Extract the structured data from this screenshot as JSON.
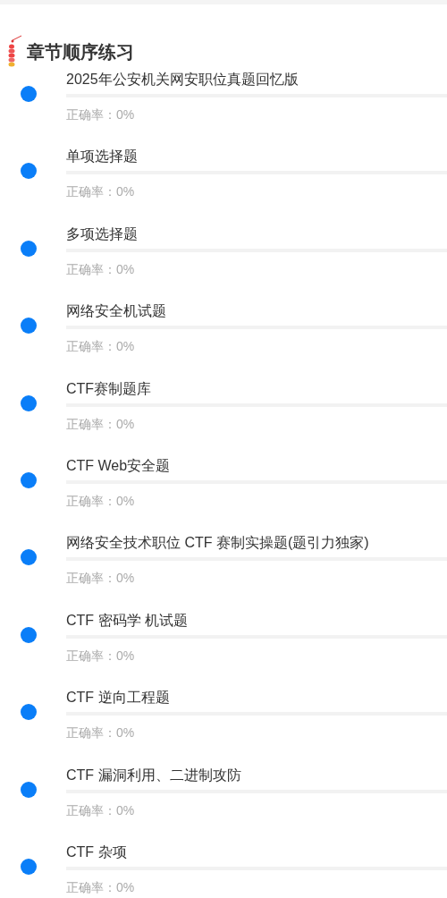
{
  "header": {
    "title": "章节顺序练习"
  },
  "chapters": [
    {
      "title": "2025年公安机关网安职位真题回忆版",
      "rate": "正确率：0%",
      "level": 0
    },
    {
      "title": "单项选择题",
      "rate": "正确率：0%",
      "level": 0
    },
    {
      "title": "多项选择题",
      "rate": "正确率：0%",
      "level": 0
    },
    {
      "title": "网络安全机试题",
      "rate": "正确率：0%",
      "level": 0
    },
    {
      "title": "CTF赛制题库",
      "rate": "正确率：0%",
      "level": 0
    },
    {
      "title": "CTF Web安全题",
      "rate": "正确率：0%",
      "level": 0
    },
    {
      "title": "网络安全技术职位 CTF 赛制实操题(题引力独家)",
      "rate": "正确率：0%",
      "level": 0
    },
    {
      "title": "CTF 密码学 机试题",
      "rate": "正确率：0%",
      "level": 0
    },
    {
      "title": "CTF 逆向工程题",
      "rate": "正确率：0%",
      "level": 0
    },
    {
      "title": "CTF 漏洞利用、二进制攻防",
      "rate": "正确率：0%",
      "level": 0
    },
    {
      "title": "CTF 杂项",
      "rate": "正确率：0%",
      "level": 0
    }
  ]
}
